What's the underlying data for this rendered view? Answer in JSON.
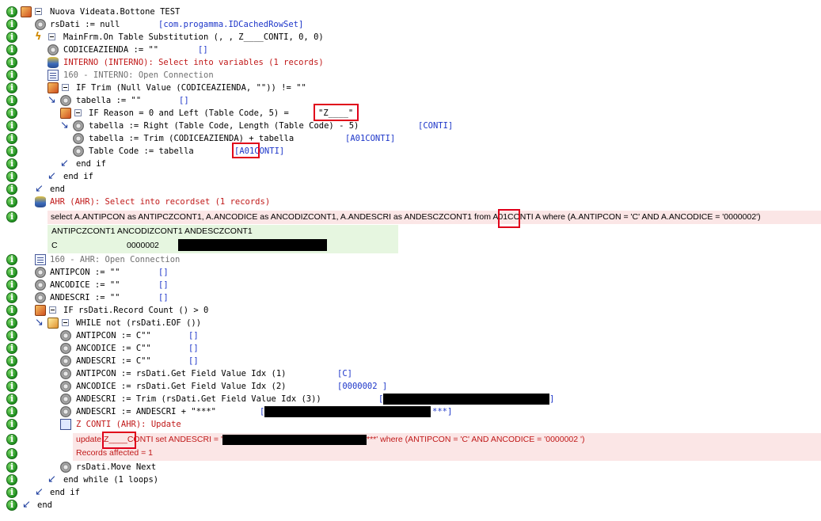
{
  "colors": {
    "keyword_blue": "#1d36c9",
    "sql_red": "#c01818",
    "sql_bg": "#fbe6e6",
    "grid_bg": "#e6f6e0",
    "highlight": "#e0001a"
  },
  "lines": [
    {
      "icon": "start-icon",
      "text": "Nuova Videata.Bottone TEST",
      "value": ""
    },
    {
      "icon": "gear-icon",
      "text": "rsDati := null",
      "value": "[com.progamma.IDCachedRowSet]"
    },
    {
      "icon": "event-icon",
      "text": "MainFrm.On Table Substitution (, , Z____CONTI, 0, 0)",
      "value": ""
    },
    {
      "icon": "gear-icon",
      "text": "CODICEAZIENDA := \"\"",
      "value": "[]"
    },
    {
      "icon": "database-icon",
      "text": "INTERNO (INTERNO): Select into variables (1 records)",
      "value": ""
    },
    {
      "icon": "connection-icon",
      "text": "160 - INTERNO: Open Connection",
      "value": ""
    },
    {
      "icon": "if-icon",
      "text": "IF Trim (Null Value (CODICEAZIENDA, \"\")) != \"\"",
      "value": ""
    },
    {
      "icon": "gear-icon",
      "text": "tabella := \"\"",
      "value": "[]"
    },
    {
      "icon": "if-icon",
      "text": "IF Reason = 0 and Left (Table Code, 5) = ",
      "value": "\"Z____\""
    },
    {
      "icon": "gear-icon",
      "text": "tabella := Right (Table Code, Length (Table Code) - 5)",
      "value": "[CONTI]"
    },
    {
      "icon": "gear-icon",
      "text": "tabella := Trim (CODICEAZIENDA) + tabella",
      "value": "[A01CONTI]"
    },
    {
      "icon": "gear-icon",
      "text": "Table Code := tabella",
      "value": "[A01CONTI]"
    },
    {
      "icon": "end-arrow-icon",
      "text": "end if",
      "value": ""
    },
    {
      "icon": "end-arrow-icon",
      "text": "end if",
      "value": ""
    },
    {
      "icon": "end-arrow-icon",
      "text": "end",
      "value": ""
    },
    {
      "icon": "database-icon",
      "text": "AHR (AHR): Select into recordset (1 records)",
      "value": ""
    }
  ],
  "sql_select": "select  A.ANTIPCON as ANTIPCZCONT1,  A.ANCODICE as ANCODIZCONT1,  A.ANDESCRI as ANDESCZCONT1 from A01CONTI A where (A.ANTIPCON = 'C' AND A.ANCODICE = '0000002')",
  "result_grid": {
    "headers": "ANTIPCZCONT1 ANCODIZCONT1 ANDESCZCONT1",
    "row_c": "C",
    "row_code": "0000002"
  },
  "lines2": [
    {
      "icon": "connection-icon",
      "text": "160 - AHR: Open Connection",
      "value": ""
    },
    {
      "icon": "gear-icon",
      "text": "ANTIPCON := \"\"",
      "value": "[]"
    },
    {
      "icon": "gear-icon",
      "text": "ANCODICE := \"\"",
      "value": "[]"
    },
    {
      "icon": "gear-icon",
      "text": "ANDESCRI := \"\"",
      "value": "[]"
    },
    {
      "icon": "if-icon",
      "text": "IF rsDati.Record Count () > 0",
      "value": ""
    },
    {
      "icon": "loop-icon",
      "text": "WHILE not (rsDati.EOF ())",
      "value": ""
    },
    {
      "icon": "gear-icon",
      "text": "ANTIPCON := C\"\"",
      "value": "[]"
    },
    {
      "icon": "gear-icon",
      "text": "ANCODICE := C\"\"",
      "value": "[]"
    },
    {
      "icon": "gear-icon",
      "text": "ANDESCRI := C\"\"",
      "value": "[]"
    },
    {
      "icon": "gear-icon",
      "text": "ANTIPCON := rsDati.Get Field Value Idx (1)",
      "value": "[C]"
    },
    {
      "icon": "gear-icon",
      "text": "ANCODICE := rsDati.Get Field Value Idx (2)",
      "value": "[0000002         ]"
    },
    {
      "icon": "gear-icon",
      "text": "ANDESCRI := Trim (rsDati.Get Field Value Idx (3))",
      "value": "[",
      "value_end": "]"
    },
    {
      "icon": "gear-icon",
      "text": "ANDESCRI := ANDESCRI + \"***\"",
      "value": "[",
      "value_end": "***]"
    },
    {
      "icon": "update-icon",
      "text": "Z CONTI (AHR): Update",
      "value": ""
    }
  ],
  "sql_update": {
    "prefix": "update ",
    "table": "Z____CONTI set  ANDESCRI = '",
    "suffix": "***' where (ANTIPCON = 'C' AND ANCODICE = '0000002        ')",
    "affected": "Records affected = 1"
  },
  "lines3": [
    {
      "icon": "gear-icon",
      "text": "rsDati.Move Next",
      "value": ""
    },
    {
      "icon": "end-arrow-icon",
      "text": "end while (1 loops)",
      "value": ""
    },
    {
      "icon": "end-arrow-icon",
      "text": "end if",
      "value": ""
    },
    {
      "icon": "end-arrow-icon",
      "text": "end",
      "value": ""
    }
  ]
}
